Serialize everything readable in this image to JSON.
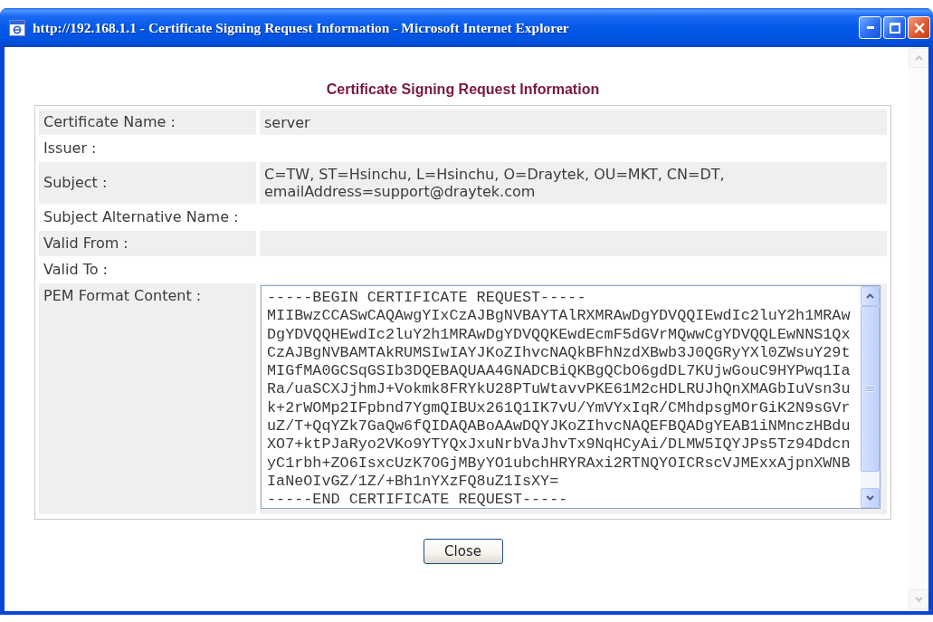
{
  "window": {
    "title": "http://192.168.1.1 - Certificate Signing Request Information - Microsoft Internet Explorer"
  },
  "heading": "Certificate Signing Request Information",
  "fields": [
    {
      "kind": "text",
      "label": "Certificate Name :",
      "value": "server"
    },
    {
      "kind": "text",
      "label": "Issuer :"
    },
    {
      "kind": "text",
      "label": "Subject :",
      "value": "C=TW, ST=Hsinchu, L=Hsinchu, O=Draytek, OU=MKT, CN=DT, emailAddress=support@draytek.com"
    },
    {
      "kind": "text",
      "label": "Subject Alternative Name :"
    },
    {
      "kind": "text",
      "label": "Valid From :"
    },
    {
      "kind": "text",
      "label": "Valid To :"
    },
    {
      "kind": "textarea",
      "label": "PEM Format Content :",
      "lines": [
        "-----BEGIN CERTIFICATE REQUEST-----",
        "MIIBwzCCASwCAQAwgYIxCzAJBgNVBAYTAlRXMRAwDgYDVQQIEwdIc2luY2h1MRAw",
        "DgYDVQQHEwdIc2luY2h1MRAwDgYDVQQKEwdEcmF5dGVrMQwwCgYDVQQLEwNNS1Qx",
        "CzAJBgNVBAMTAkRUMSIwIAYJKoZIhvcNAQkBFhNzdXBwb3J0QGRyYXl0ZWsuY29t",
        "MIGfMA0GCSqGSIb3DQEBAQUAA4GNADCBiQKBgQCbO6gdDL7KUjwGouC9HYPwq1Ia",
        "Ra/uaSCXJjhmJ+Vokmk8FRYkU28PTuWtavvPKE61M2cHDLRUJhQnXMAGbIuVsn3u",
        "k+2rWOMp2IFpbnd7YgmQIBUx261Q1IK7vU/YmVYxIqR/CMhdpsgMOrGiK2N9sGVr",
        "uZ/T+QqYZk7GaQw6fQIDAQABoAAwDQYJKoZIhvcNAQEFBQADgYEAB1iNMnczHBdu",
        "XO7+ktPJaRyo2VKo9YTYQxJxuNrbVaJhvTx9NqHCyAi/DLMW5IQYJPs5Tz94Ddcn",
        "yC1rbh+ZO6IsxcUzK7OGjMByYO1ubchHRYRAxi2RTNQYOICRscVJMExxAjpnXWNB",
        "IaNeOIvGZ/1Z/+Bh1nYXzFQ8uZ1IsXY=",
        "-----END CERTIFICATE REQUEST-----"
      ]
    }
  ],
  "buttons": [
    "Close"
  ]
}
